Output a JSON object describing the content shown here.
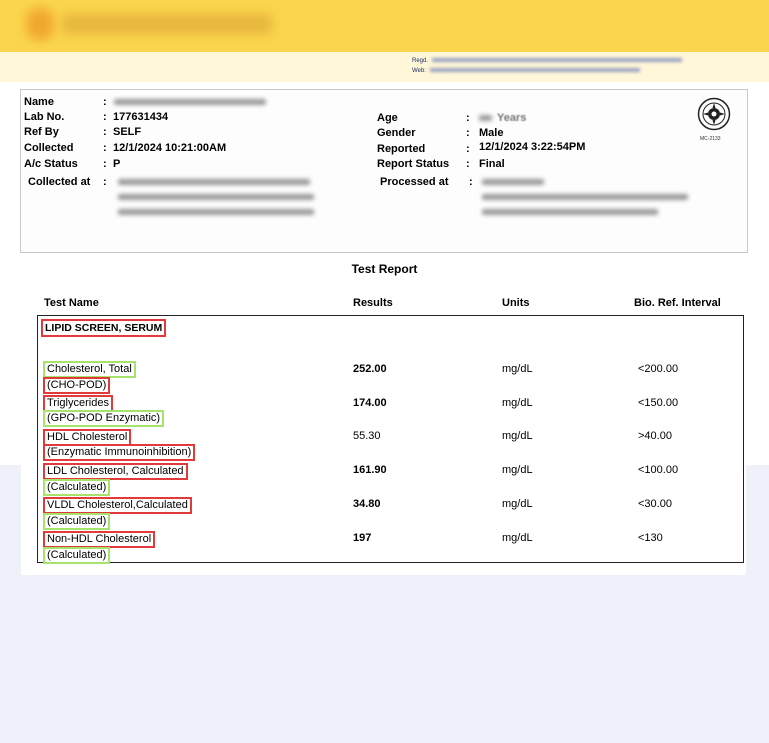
{
  "header": {
    "regd_label": "Regd.",
    "web_label": "Web:"
  },
  "patient": {
    "name_label": "Name",
    "lab_no_label": "Lab No.",
    "lab_no": "177631434",
    "ref_by_label": "Ref By",
    "ref_by": "SELF",
    "collected_label": "Collected",
    "collected": "12/1/2024  10:21:00AM",
    "ac_status_label": "A/c Status",
    "ac_status": "P",
    "collected_at_label": "Collected at",
    "age_label": "Age",
    "age_unit": "Years",
    "gender_label": "Gender",
    "gender": "Male",
    "reported_label": "Reported",
    "reported": "12/1/2024  3:22:54PM",
    "report_status_label": "Report Status",
    "report_status": "Final",
    "processed_at_label": "Processed at",
    "seal_caption": "MC-2133",
    "colon": ":"
  },
  "report": {
    "title": "Test Report",
    "columns": {
      "test_name": "Test Name",
      "results": "Results",
      "units": "Units",
      "ref": "Bio. Ref. Interval"
    },
    "section": "LIPID SCREEN, SERUM",
    "rows": [
      {
        "name": "Cholesterol, Total",
        "method": "(CHO-POD)",
        "result": "252.00",
        "unit": "mg/dL",
        "ref": "<200.00"
      },
      {
        "name": "Triglycerides",
        "method": "(GPO-POD Enzymatic)",
        "result": "174.00",
        "unit": "mg/dL",
        "ref": "<150.00"
      },
      {
        "name": "HDL Cholesterol",
        "method": "(Enzymatic Immunoinhibition)",
        "result": "55.30",
        "unit": "mg/dL",
        "ref": ">40.00"
      },
      {
        "name": "LDL Cholesterol, Calculated",
        "method": "(Calculated)",
        "result": "161.90",
        "unit": "mg/dL",
        "ref": "<100.00"
      },
      {
        "name": "VLDL Cholesterol,Calculated",
        "method": "(Calculated)",
        "result": "34.80",
        "unit": "mg/dL",
        "ref": "<30.00"
      },
      {
        "name": "Non-HDL Cholesterol",
        "method": "(Calculated)",
        "result": "197",
        "unit": "mg/dL",
        "ref": "<130"
      }
    ]
  },
  "colors": {
    "header_yellow": "#fbd54d",
    "highlight_red": "#e03a3a",
    "highlight_green": "#a6e36a"
  }
}
